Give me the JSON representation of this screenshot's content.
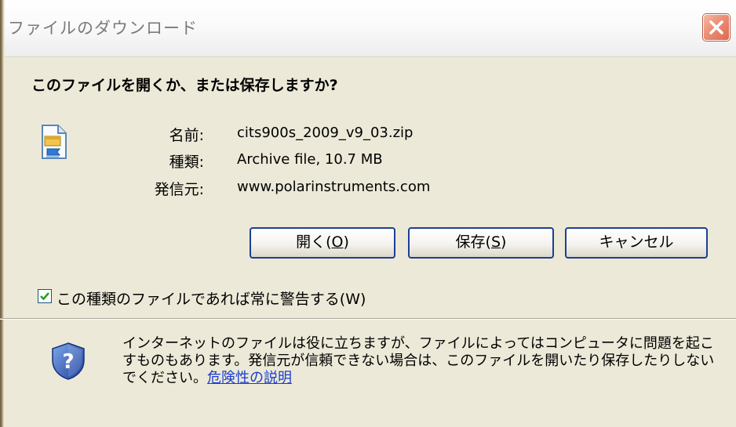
{
  "window": {
    "title": "ファイルのダウンロード"
  },
  "dialog": {
    "question": "このファイルを開くか、または保存しますか?",
    "file_icon": "zip-archive-file-icon",
    "info": {
      "name_label": "名前:",
      "name_value": "cits900s_2009_v9_03.zip",
      "type_label": "種類:",
      "type_value": "Archive file, 10.7 MB",
      "source_label": "発信元:",
      "source_value": "www.polarinstruments.com"
    },
    "buttons": {
      "open_text": "開く(",
      "open_key": "O",
      "open_close": ")",
      "save_text": "保存(",
      "save_key": "S",
      "save_close": ")",
      "cancel": "キャンセル"
    },
    "checkbox": {
      "label": "この種類のファイルであれば常に警告する(W)",
      "checked": true
    },
    "warning": {
      "icon": "shield-question-icon",
      "text": "インターネットのファイルは役に立ちますが、ファイルによってはコンピュータに問題を起こすものもあります。発信元が信頼できない場合は、このファイルを開いたり保存したりしないでください。",
      "link": "危険性の説明"
    }
  },
  "colors": {
    "dialog_bg": "#ece9d8",
    "button_border": "#1c3f95",
    "close_red": "#dd6850",
    "link": "#1a3dcf"
  }
}
